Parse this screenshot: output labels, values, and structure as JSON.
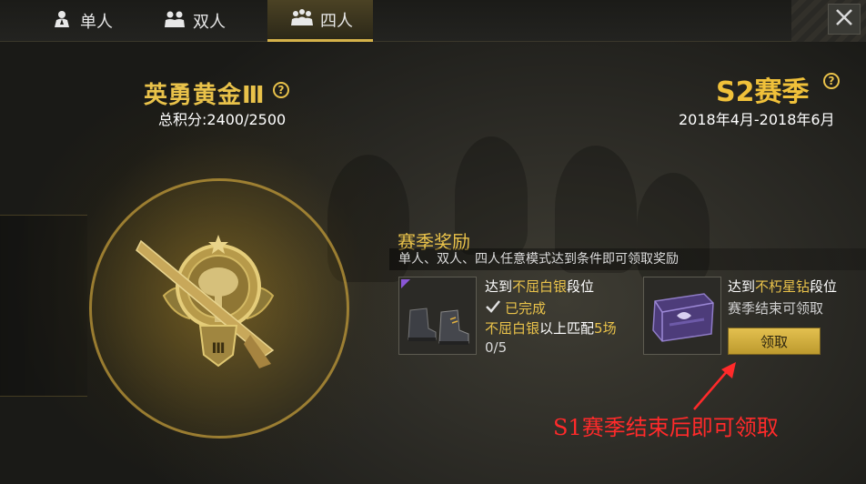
{
  "tabs": [
    {
      "label": "单人",
      "icon": "solo-person-icon",
      "active": false
    },
    {
      "label": "双人",
      "icon": "duo-persons-icon",
      "active": false
    },
    {
      "label": "四人",
      "icon": "squad-persons-icon",
      "active": true
    }
  ],
  "rank": {
    "title": "英勇黄金Ⅲ",
    "score_text": "总积分:2400/2500",
    "tier_numeral": "Ⅲ"
  },
  "season": {
    "title": "S2赛季",
    "dates": "2018年4月-2018年6月"
  },
  "rewards": {
    "title": "赛季奖励",
    "description": "单人、双人、四人任意模式达到条件即可领取奖励",
    "item1": {
      "prefix": "达到",
      "rank": "不屈白银",
      "suffix": "段位",
      "status": "已完成",
      "cond_rank": "不屈白银",
      "cond_mid": "以上匹配",
      "cond_count": "5场",
      "progress": "0/5"
    },
    "item2": {
      "prefix": "达到",
      "rank": "不朽星钻",
      "suffix": "段位",
      "note": "赛季结束可领取",
      "claim_label": "领取"
    }
  },
  "annotation": "S1赛季结束后即可领取",
  "colors": {
    "gold": "#e9c24a",
    "annotation": "#ff2a2a",
    "rarity_purple": "#8a56d6"
  }
}
